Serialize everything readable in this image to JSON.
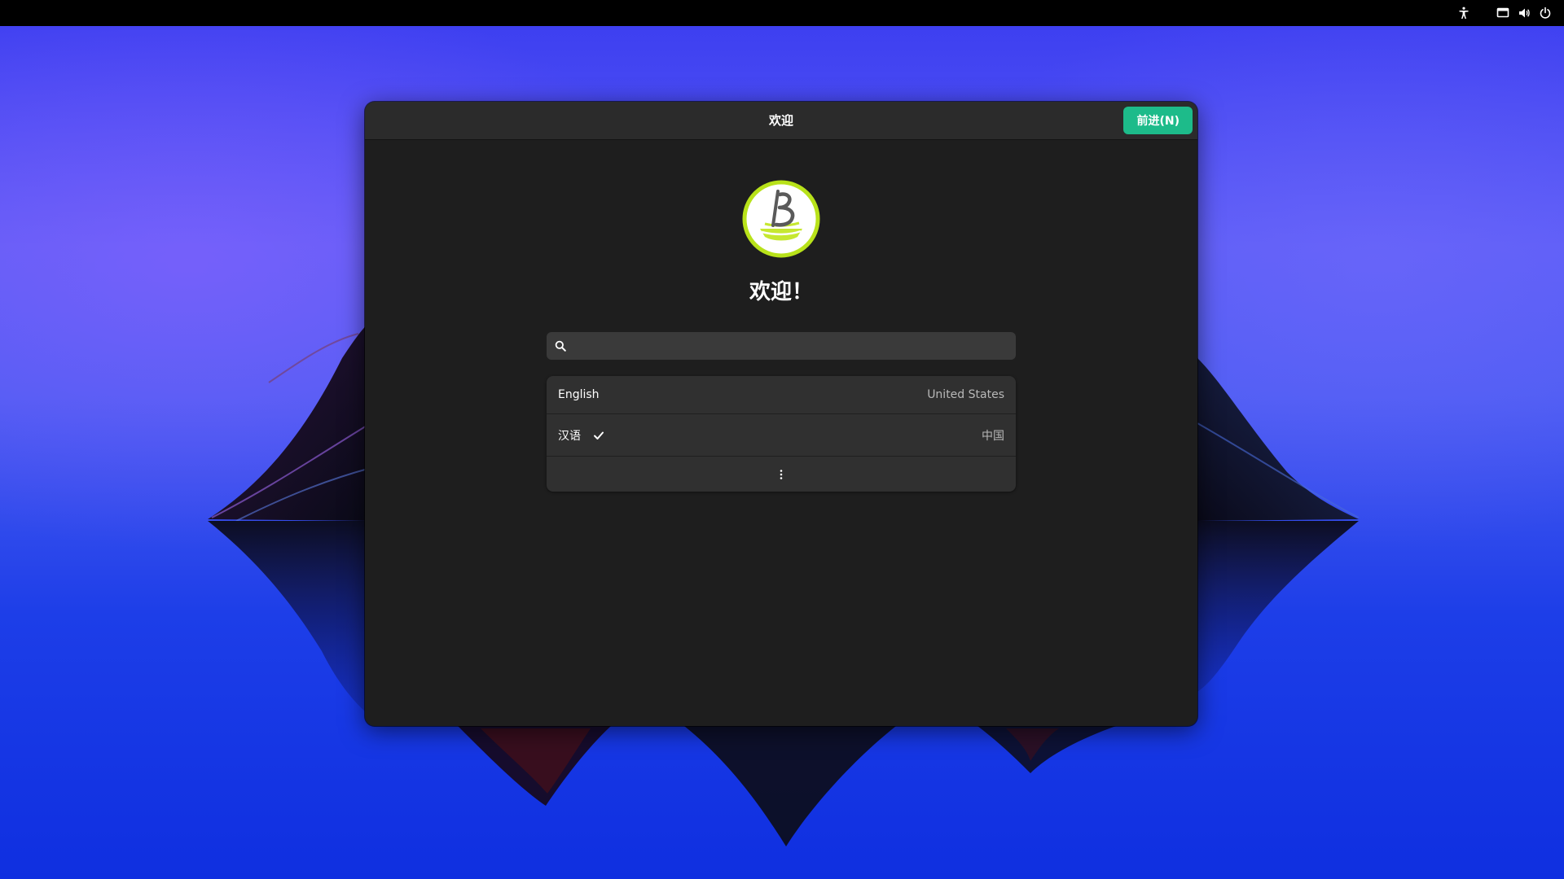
{
  "colors": {
    "topbar": "#000000",
    "window_bg": "#1e1e1e",
    "headerbar_bg": "#2b2b2b",
    "accent": "#1dbb8a",
    "list_bg": "#303030",
    "search_bg": "#3a3a3a",
    "logo_ring": "#b8e21a"
  },
  "topbar": {
    "icons": [
      "accessibility-icon",
      "display-icon",
      "volume-icon",
      "power-icon"
    ]
  },
  "window": {
    "title": "欢迎",
    "next_button_label": "前进(N)"
  },
  "welcome": {
    "logo_icon": "boat-logo-icon",
    "heading": "欢迎！"
  },
  "search": {
    "placeholder": "",
    "value": ""
  },
  "languages": [
    {
      "name": "English",
      "region": "United States",
      "selected": false
    },
    {
      "name": "汉语",
      "region": "中国",
      "selected": true
    }
  ],
  "more_label": "⋮"
}
